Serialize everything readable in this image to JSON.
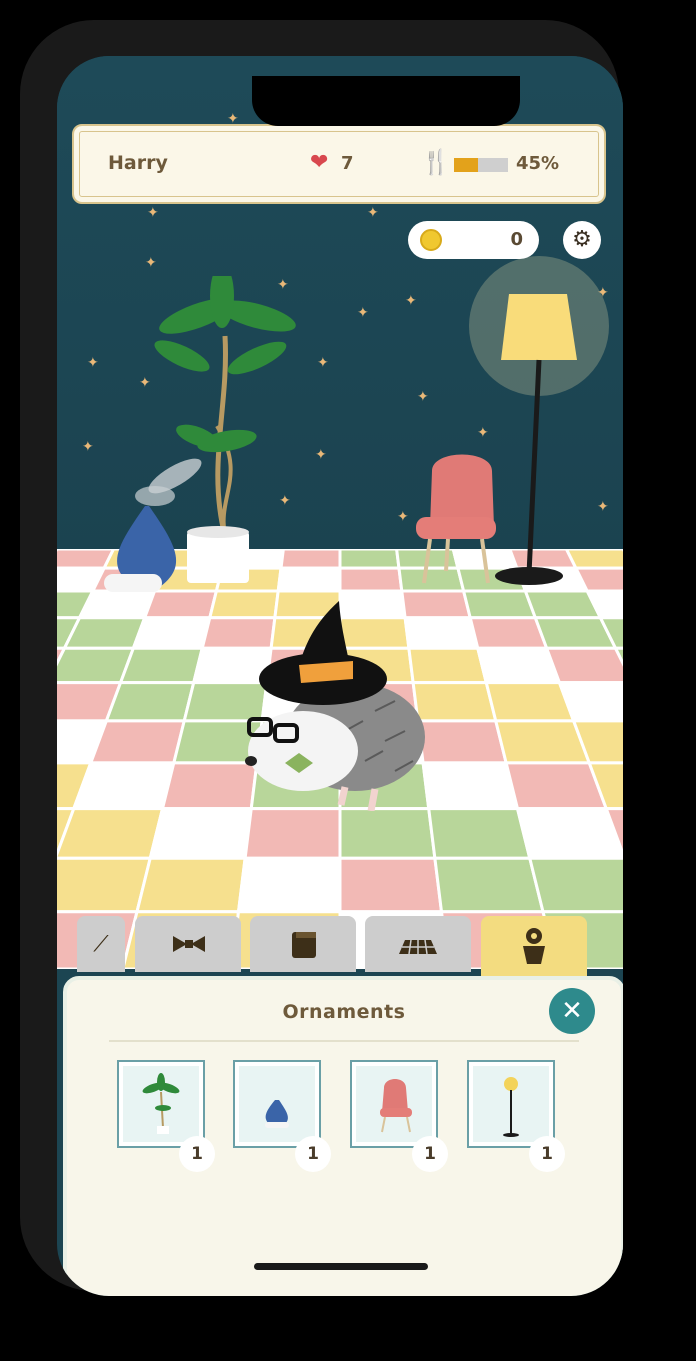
{
  "status_bar": {
    "pet_name": "Harry",
    "hearts": "7",
    "food_level": 0.45,
    "food_percent": "45%"
  },
  "coins": {
    "value": "0"
  },
  "tabs": [
    {
      "name": "accessories-tab",
      "icon": "partial-icon"
    },
    {
      "name": "bowtie-tab",
      "icon": "bowtie-icon"
    },
    {
      "name": "wallpaper-tab",
      "icon": "scroll-icon"
    },
    {
      "name": "floor-tab",
      "icon": "floor-tile-icon"
    },
    {
      "name": "ornaments-tab",
      "icon": "flower-pot-icon",
      "active": true
    }
  ],
  "panel": {
    "title": "Ornaments",
    "items": [
      {
        "icon": "palm-plant-icon",
        "count": "1"
      },
      {
        "icon": "humidifier-icon",
        "count": "1"
      },
      {
        "icon": "pink-chair-icon",
        "count": "1"
      },
      {
        "icon": "floor-lamp-icon",
        "count": "1"
      }
    ]
  },
  "colors": {
    "wall": "#1c4552",
    "accent": "#2e8a8c",
    "panel": "#f8f6ea",
    "active_tab": "#f3dc80"
  }
}
